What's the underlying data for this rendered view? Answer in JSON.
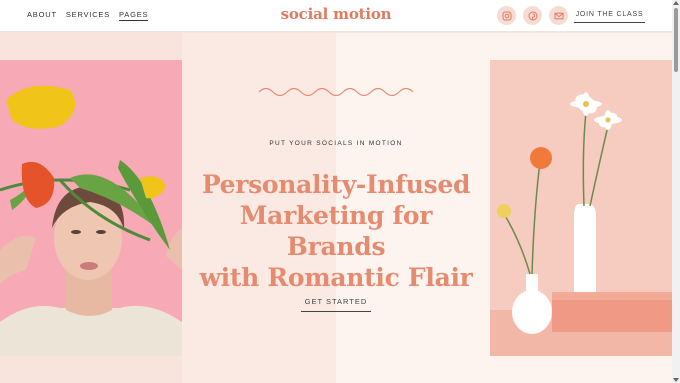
{
  "nav": {
    "items": [
      {
        "label": "ABOUT",
        "active": false
      },
      {
        "label": "SERVICES",
        "active": false
      },
      {
        "label": "PAGES",
        "active": true
      }
    ]
  },
  "logo": "social motion",
  "social": {
    "icons": [
      "instagram-icon",
      "pinterest-icon",
      "email-icon"
    ]
  },
  "join_label": "JOIN THE CLASS",
  "hero": {
    "eyebrow": "PUT YOUR SOCIALS IN MOTION",
    "headline_lines": [
      "Personality-Infused",
      "Marketing for Brands",
      "with Romantic Flair"
    ],
    "cta_label": "GET STARTED"
  },
  "colors": {
    "brand": "#e07a5f",
    "headline": "#e58b6f",
    "blush": "#f8e4dd",
    "pink_photo": "#f7a6b4",
    "peach_photo": "#f6cbc0"
  }
}
